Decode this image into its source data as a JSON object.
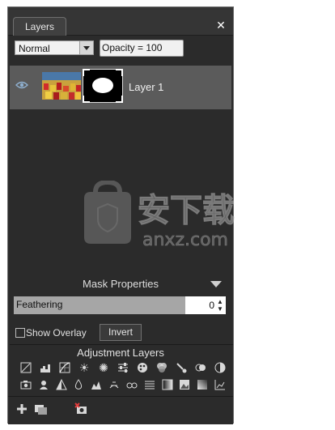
{
  "panel": {
    "tab_label": "Layers",
    "close_glyph": "✕"
  },
  "controls": {
    "blend_mode": "Normal",
    "opacity_text": "Opacity = 100"
  },
  "layer": {
    "name": "Layer 1",
    "visible": true
  },
  "watermark": {
    "text": "安下载",
    "subtext": "anxz.com"
  },
  "mask": {
    "title": "Mask Properties",
    "feathering_label": "Feathering",
    "feathering_value": "0",
    "show_overlay_label": "Show Overlay",
    "show_overlay_checked": false,
    "invert_label": "Invert"
  },
  "adjustment": {
    "title": "Adjustment Layers",
    "row1": [
      "levels-icon",
      "histogram-icon",
      "curves-grid-icon",
      "brightness-icon",
      "exposure-sun-icon",
      "sliders-icon",
      "color-palette-icon",
      "channels-icon",
      "paint-brush-icon",
      "hue-circle-icon",
      "contrast-circle-icon"
    ],
    "row2": [
      "photo-camera-icon",
      "portrait-icon",
      "triangle-icon",
      "drop-icon",
      "tone-icon",
      "texture-icon",
      "glasses-icon",
      "equalize-icon",
      "gradient-map-icon",
      "image-icon",
      "gradient-icon",
      "line-chart-icon"
    ]
  },
  "bottom": {
    "icons": [
      "add-layer-icon",
      "duplicate-layer-icon",
      "delete-layer-icon"
    ]
  }
}
